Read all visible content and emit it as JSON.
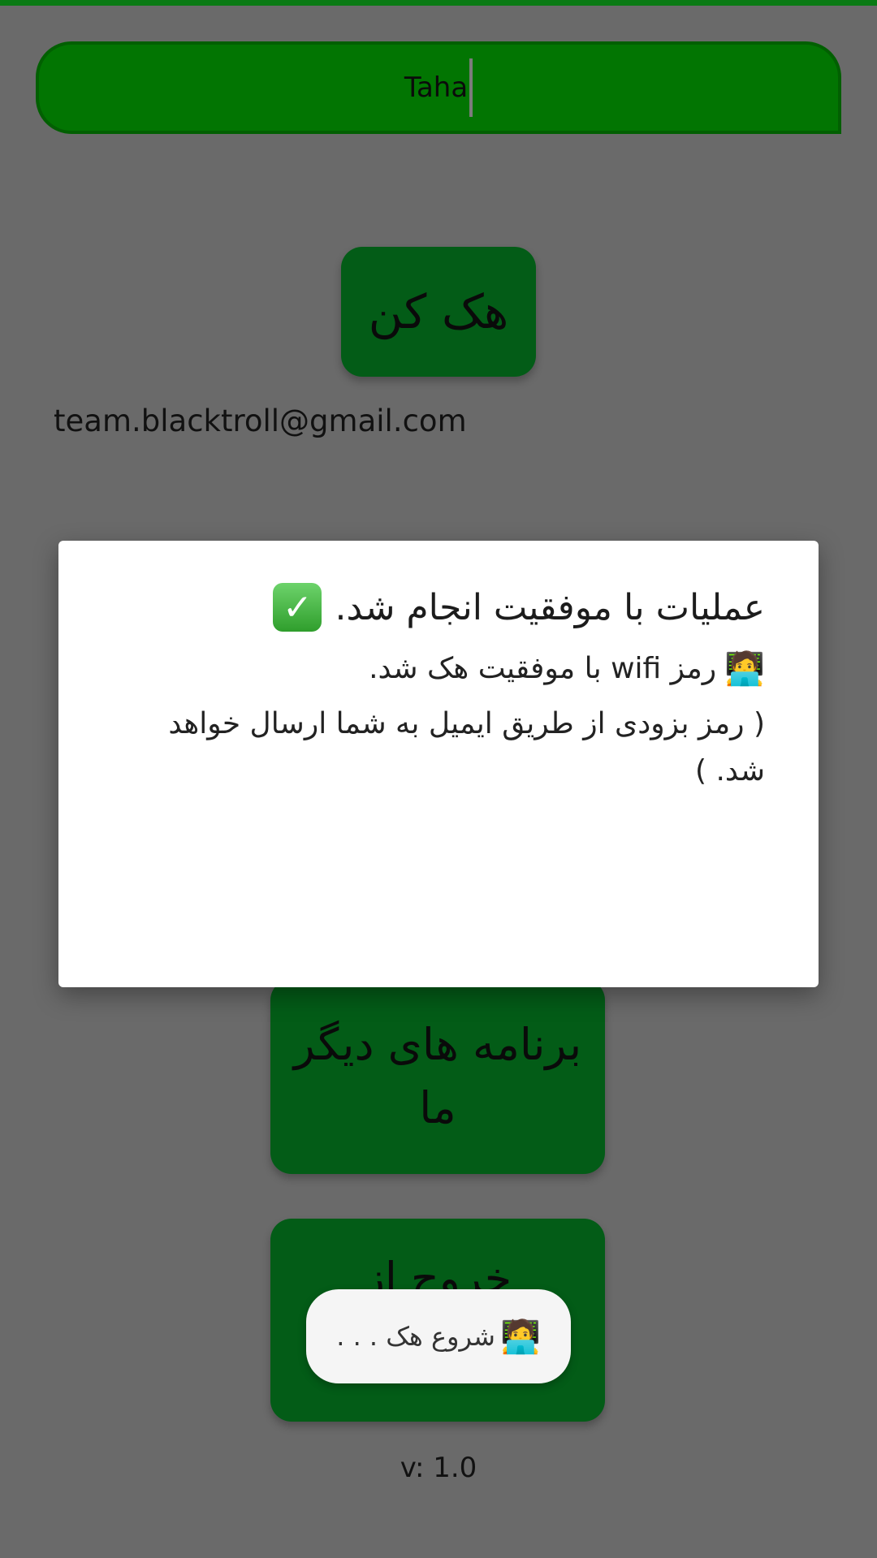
{
  "name_input": {
    "value": "Taha"
  },
  "hack_button": {
    "label": "هک کن"
  },
  "email": "team.blacktroll@gmail.com",
  "dialog": {
    "title": "عملیات با موفقیت انجام شد.",
    "title_icon": "check-mark-button-icon",
    "line1": "رمز wifi با موفقیت هک شد.",
    "line1_icon": "technologist-icon",
    "line2": "( رمز بزودی از طریق ایمیل به شما ارسال خواهد شد. )"
  },
  "other_apps_button": {
    "label": "برنامه های دیگر ما"
  },
  "exit_button": {
    "label": "خروج از"
  },
  "toast": {
    "text": "شروع هک . . .",
    "icon": "technologist-icon"
  },
  "version": "v: 1.0",
  "colors": {
    "accent": "#027502",
    "button": "#035c17",
    "scrim": "#6a6a6a",
    "dialog": "#ffffff"
  }
}
